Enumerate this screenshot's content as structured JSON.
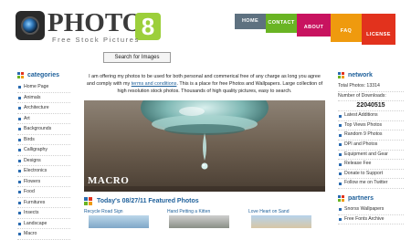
{
  "logo": {
    "title": "PHOTOS",
    "digit": "8",
    "subtitle": "Free Stock Pictures"
  },
  "nav": [
    {
      "label": "HOME",
      "color": "#5e7180"
    },
    {
      "label": "CONTACT",
      "color": "#69b423"
    },
    {
      "label": "ABOUT",
      "color": "#c8135f"
    },
    {
      "label": "FAQ",
      "color": "#ef9a0e"
    },
    {
      "label": "LICENSE",
      "color": "#e2321d"
    }
  ],
  "search": {
    "button_label": "Search for Images"
  },
  "sidebar": {
    "heading": "categories",
    "items": [
      "Home Page",
      "Animals",
      "Architecture",
      "Art",
      "Backgrounds",
      "Birds",
      "Calligraphy",
      "Designs",
      "Electronics",
      "Flowers",
      "Food",
      "Furnitures",
      "Insects",
      "Landscape",
      "Macro"
    ]
  },
  "intro": {
    "before_link": "I am offering my photos to be used for both personal and commerical free of any charge as long you agree and comply with my ",
    "link": "terms and conditions",
    "after_link": ". This is a place for free Photos and Wallpapers. Large collection of high resolution stock photos. Thousands of high quality pictures, easy to search."
  },
  "hero": {
    "caption": "MACRO"
  },
  "featured": {
    "title": "Today's 08/27/11 Featured Photos",
    "items": [
      "Recycle Road Sign",
      "Hand Petting a Kitten",
      "Love Heart on Sand"
    ]
  },
  "network": {
    "heading": "network",
    "total_label": "Total Photos: 13314",
    "downloads_label": "Number of Downloads:",
    "downloads_value": "22040515",
    "items": [
      "Latest Additions",
      "Top Views Photos",
      "Random 9 Photos",
      "DPI and Photos",
      "Equipment and Gear",
      "Release Fee",
      "Donate to Support",
      "Follow me on Twitter"
    ]
  },
  "partners": {
    "heading": "partners",
    "items": [
      "Snorss Wallpapers",
      "Free Fonts Archive"
    ]
  },
  "colors": {
    "link": "#1d5f9a",
    "accent_green": "#9ccf3b"
  }
}
